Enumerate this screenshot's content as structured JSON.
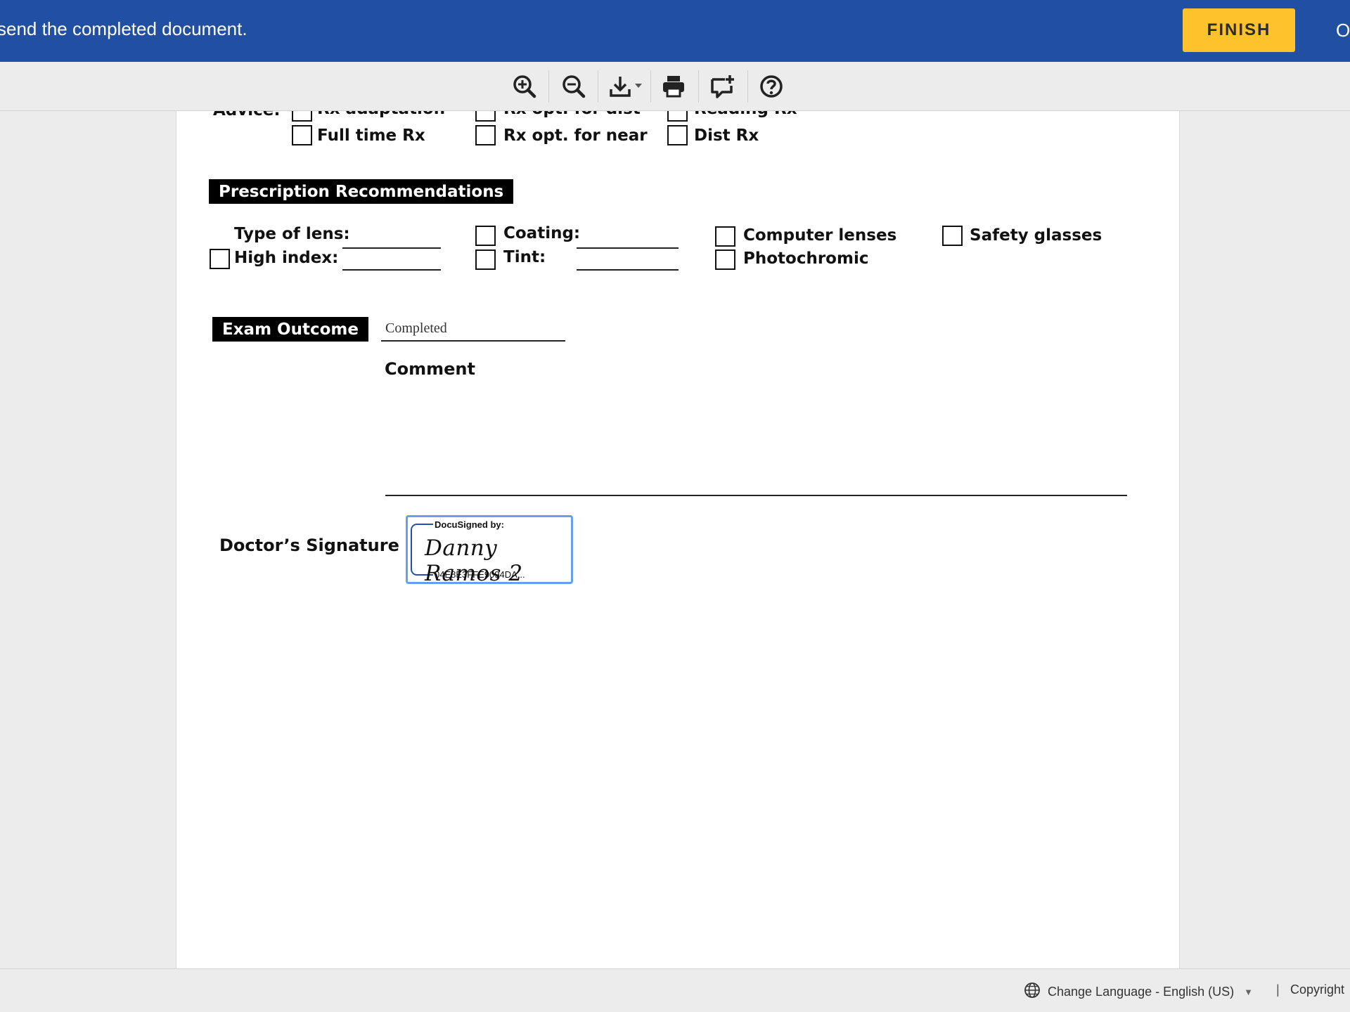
{
  "banner": {
    "message": "send the completed document.",
    "finish_label": "FINISH",
    "other_label": "O",
    "color": "#214fa1",
    "finish_color": "#fdc22c"
  },
  "toolbar": {
    "icons": [
      "zoom-in-icon",
      "zoom-out-icon",
      "download-icon",
      "print-icon",
      "add-comment-icon",
      "help-icon"
    ]
  },
  "document": {
    "advice": {
      "label": "Advice:",
      "row_top": [
        "Rx adaptation",
        "Rx opt. for dist",
        "Reading Rx"
      ],
      "row_bottom": [
        "Full time Rx",
        "Rx opt. for near",
        "Dist Rx"
      ]
    },
    "prescription": {
      "heading": "Prescription Recommendations",
      "type_of_lens": "Type of lens:",
      "high_index": "High index:",
      "coating": "Coating:",
      "tint": "Tint:",
      "computer_lenses": "Computer lenses",
      "photochromic": "Photochromic",
      "safety_glasses": "Safety glasses"
    },
    "exam_outcome": {
      "heading": "Exam Outcome",
      "value": "Completed",
      "comment_label": "Comment"
    },
    "signature": {
      "label": "Doctor’s Signature",
      "header": "DocuSigned by:",
      "name": "Danny Ramos 2",
      "id": "04E8E3FFE9094DA..."
    }
  },
  "footer": {
    "language": "Change Language - English (US)",
    "separator": "|",
    "copyright": "Copyright"
  }
}
